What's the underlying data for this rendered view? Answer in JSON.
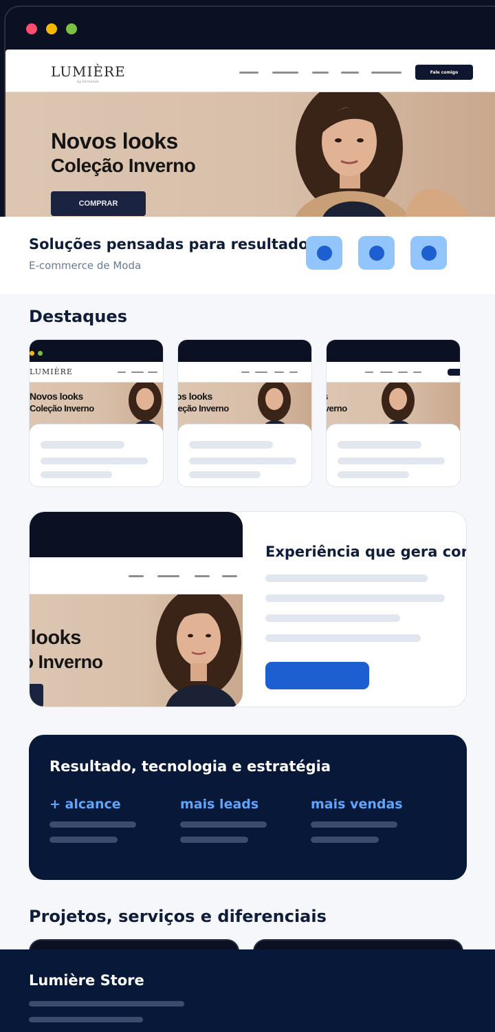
{
  "mockup": {
    "logo": "LUMIÈRE",
    "logo_sub": "by Fernanda",
    "headline_1": "Novos looks",
    "headline_2": "Coleção Inverno",
    "hero_button": "COMPRAR",
    "nav_cta": "Fale comigo"
  },
  "intro": {
    "title": "Soluções pensadas para resultados",
    "subtitle": "E-commerce de Moda"
  },
  "destaques": {
    "title": "Destaques"
  },
  "feature": {
    "title": "Experiência que gera confiança"
  },
  "results": {
    "title": "Resultado, tecnologia e estratégia",
    "metrics": [
      "+ alcance",
      "mais leads",
      "mais vendas"
    ]
  },
  "projetos": {
    "title": "Projetos, serviços e diferenciais"
  },
  "footer": {
    "title": "Lumière Store"
  },
  "colors": {
    "navy": "#081838",
    "accent": "#1d5fd1",
    "accent_light": "#93c5fd",
    "metric_blue": "#60a5fa"
  }
}
